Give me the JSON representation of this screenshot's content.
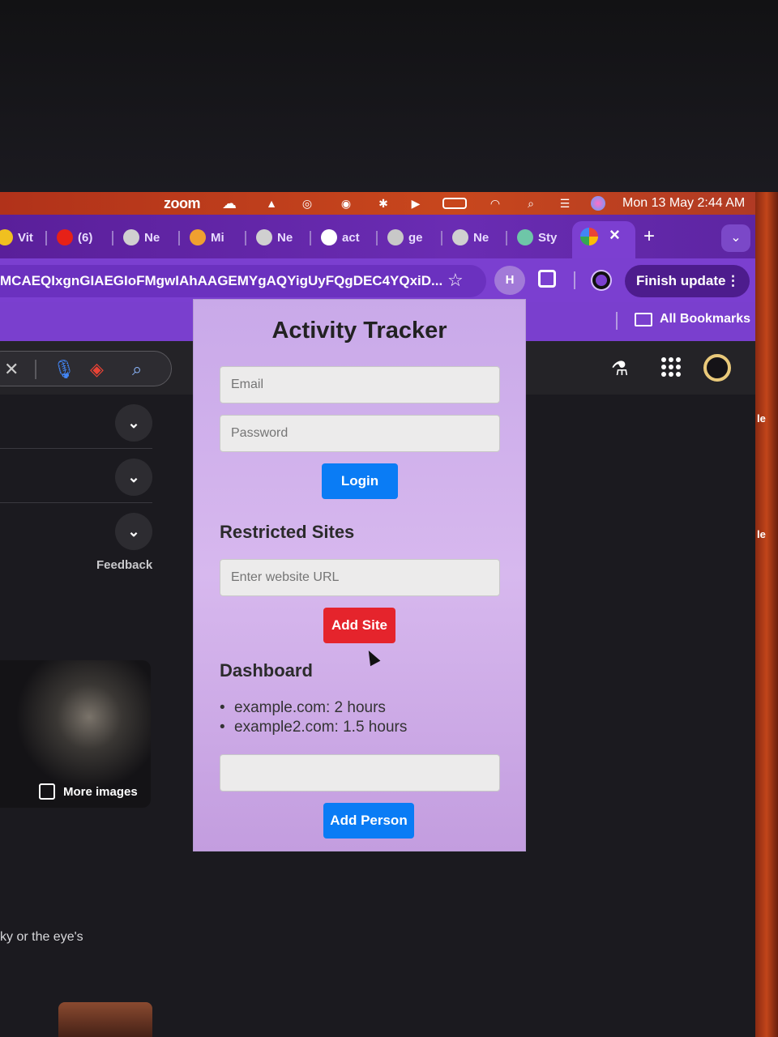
{
  "menubar": {
    "zoom_label": "zoom",
    "clock": "Mon 13 May  2:44 AM"
  },
  "tabs": [
    {
      "label": "Vit",
      "favicon_color": "#f0c020"
    },
    {
      "label": "(6)",
      "favicon_color": "#e62117"
    },
    {
      "label": "Ne",
      "favicon_color": "#d0d0d0"
    },
    {
      "label": "Mi",
      "favicon_color": "#f0a030"
    },
    {
      "label": "Ne",
      "favicon_color": "#d0d0d0"
    },
    {
      "label": "act",
      "favicon_color": "#ffffff"
    },
    {
      "label": "ge",
      "favicon_color": "#c8c8c8"
    },
    {
      "label": "Ne",
      "favicon_color": "#d0d0d0"
    },
    {
      "label": "Sty",
      "favicon_color": "#6ec6a8"
    }
  ],
  "active_tab": {
    "close": "×"
  },
  "toolbar": {
    "url": "MCAEQIxgnGIAEGIoFMgwIAhAAGEMYgAQYigUyFQgDEC4YQxiD...",
    "profile_initial": "H",
    "finish_update": "Finish update"
  },
  "bookmarks": {
    "all_bookmarks": "All Bookmarks"
  },
  "google": {
    "feedback": "Feedback",
    "more_images": "More images",
    "snippet": "ky or the eye's",
    "right_fragment_1": "le",
    "right_fragment_2": "le"
  },
  "popup": {
    "title": "Activity Tracker",
    "email_placeholder": "Email",
    "password_placeholder": "Password",
    "login_label": "Login",
    "restricted_heading": "Restricted Sites",
    "url_placeholder": "Enter website URL",
    "add_site_label": "Add Site",
    "dashboard_heading": "Dashboard",
    "dashboard_items": [
      "example.com: 2 hours",
      "example2.com: 1.5 hours"
    ],
    "person_value": "",
    "add_person_label": "Add Person",
    "colors": {
      "primary_button": "#0a7cf5",
      "danger_button": "#e5242c",
      "popup_bg": "#d2b4ec"
    }
  }
}
